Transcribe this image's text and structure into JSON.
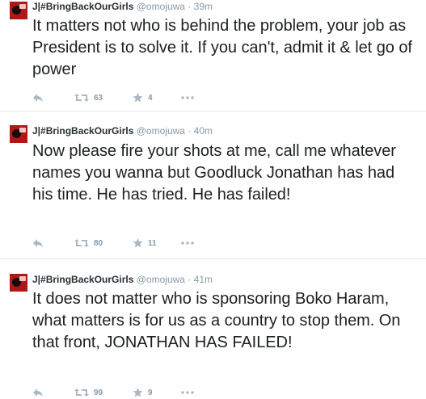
{
  "tweets": [
    {
      "name": "J|#BringBackOurGirls",
      "handle": "@omojuwa",
      "dot": "·",
      "time": "39m",
      "text": "It matters not who is behind the problem, your job as President is to solve it. If you can't, admit it & let go of power",
      "retweets": "63",
      "favorites": "4"
    },
    {
      "name": "J|#BringBackOurGirls",
      "handle": "@omojuwa",
      "dot": "·",
      "time": "40m",
      "text": "Now please fire your shots at me, call me whatever names you wanna but Goodluck Jonathan has had his time. He has tried. He has failed!",
      "retweets": "80",
      "favorites": "11"
    },
    {
      "name": "J|#BringBackOurGirls",
      "handle": "@omojuwa",
      "dot": "·",
      "time": "41m",
      "text": "It does not matter who is sponsoring Boko Haram, what matters is for us as a country to stop them. On that front, JONATHAN HAS FAILED!",
      "retweets": "99",
      "favorites": "9"
    }
  ],
  "icons": {
    "reply": "reply-icon",
    "retweet": "retweet-icon",
    "favorite": "star-icon",
    "more": "more-icon"
  },
  "colors": {
    "text": "#1c2022",
    "meta": "#8899a6",
    "divider": "#e1e8ed",
    "avatar": "#b01818"
  }
}
